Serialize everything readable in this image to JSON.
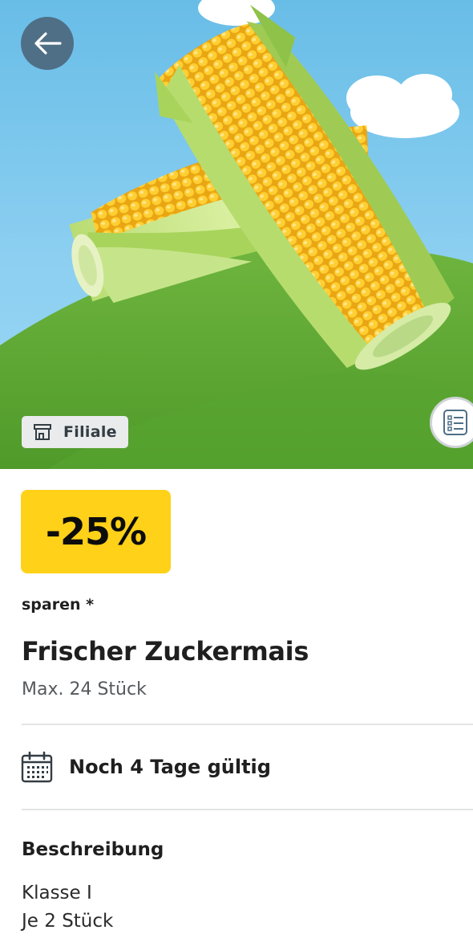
{
  "hero": {
    "image_alt": "Frischer Zuckermais",
    "store_badge_label": "Filiale",
    "store_icon": "store-icon",
    "back_icon": "arrow-left-icon",
    "list_icon": "shopping-list-icon"
  },
  "offer": {
    "discount": "-25%",
    "discount_color": "#ffd119",
    "save_label": "sparen *",
    "title": "Frischer Zuckermais",
    "max_quantity": "Max. 24 Stück"
  },
  "validity": {
    "icon": "calendar-icon",
    "text": "Noch 4 Tage gültig"
  },
  "description": {
    "heading": "Beschreibung",
    "lines": [
      "Klasse I",
      "Je 2 Stück"
    ]
  }
}
